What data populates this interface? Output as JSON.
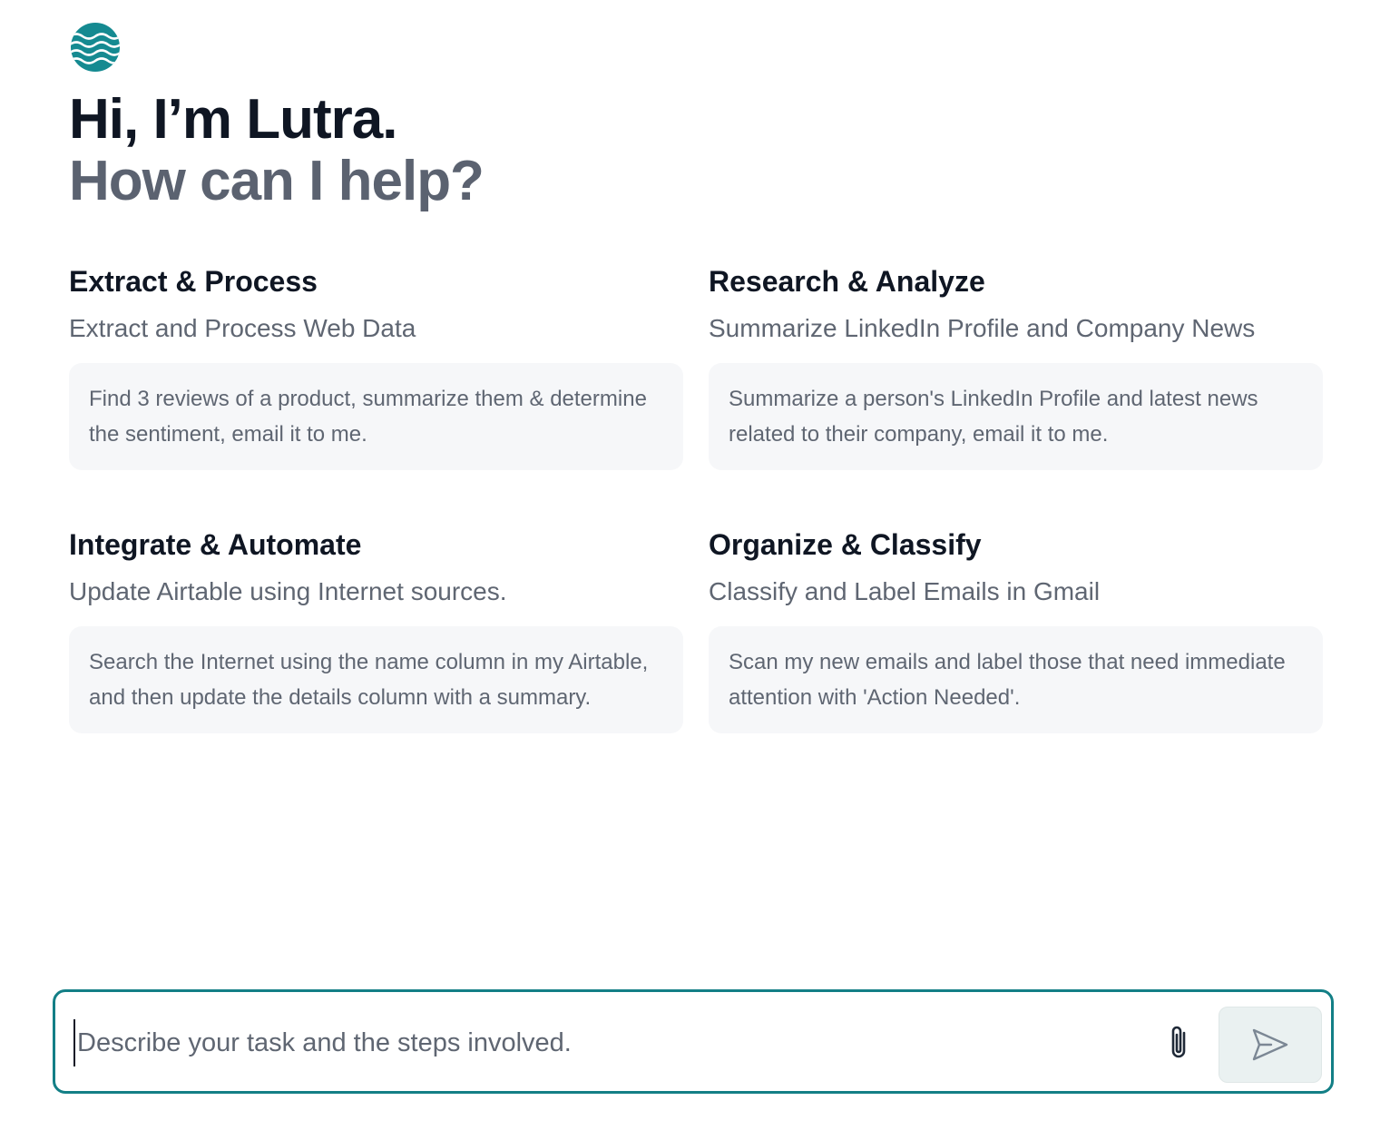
{
  "app": {
    "logo_icon": "lutra-wave-logo-icon",
    "brand_color": "#137f86"
  },
  "greeting": {
    "line1": "Hi, I’m Lutra.",
    "line2": "How can I help?"
  },
  "categories": [
    {
      "title": "Extract & Process",
      "subtitle": "Extract and Process Web Data",
      "prompt": "Find 3 reviews of a product, summarize them & determine the sentiment, email it to me."
    },
    {
      "title": "Research & Analyze",
      "subtitle": "Summarize LinkedIn Profile and Company News",
      "prompt": "Summarize a person's LinkedIn Profile and latest news related to their company, email it to me."
    },
    {
      "title": "Integrate & Automate",
      "subtitle": "Update Airtable using Internet sources.",
      "prompt": "Search the Internet using the name column in my Airtable, and then update the details column with a summary."
    },
    {
      "title": "Organize & Classify",
      "subtitle": "Classify and Label Emails in Gmail",
      "prompt": "Scan my new emails and label those that need immediate attention with 'Action Needed'."
    }
  ],
  "composer": {
    "value": "",
    "placeholder": "Describe your task and the steps involved.",
    "attach_icon": "paperclip-icon",
    "send_icon": "send-icon"
  }
}
